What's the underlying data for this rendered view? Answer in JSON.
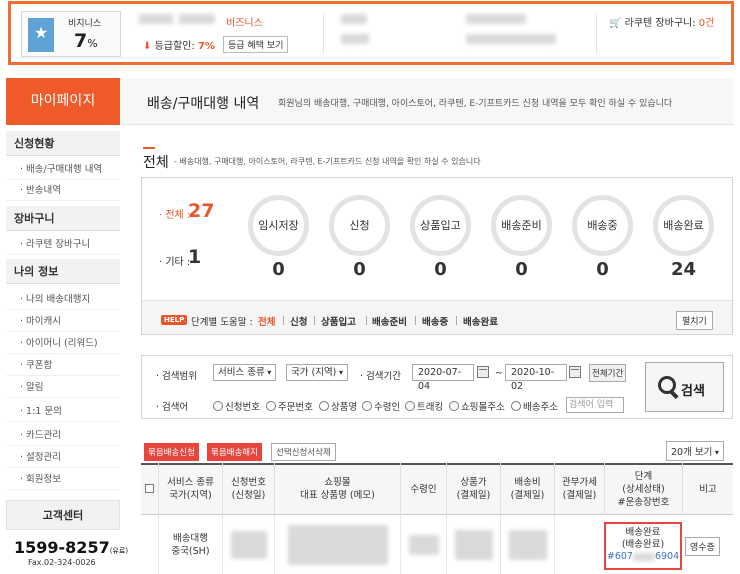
{
  "banner": {
    "grade_label": "비지니스",
    "grade_pct": "7",
    "grade_unit": "%",
    "biz_label": "비즈니스",
    "discount_label": "등급할인:",
    "discount_pct": "7%",
    "grade_btn": "등급 혜택 보기",
    "cart_label": "라쿠텐 장바구니:",
    "cart_count": "0건"
  },
  "sidebar": {
    "title": "마이페이지",
    "sections": [
      {
        "label": "신청현황",
        "items": [
          "배송/구매대행 내역",
          "반송내역"
        ]
      },
      {
        "label": "장바구니",
        "items": [
          "라쿠텐 장바구니"
        ]
      },
      {
        "label": "나의 정보",
        "items": [
          "나의 배송대행지",
          "마이캐시",
          "아이머니 (리워드)",
          "쿠폰함",
          "알림",
          "1:1 문의",
          "카드관리",
          "설정관리",
          "회원정보"
        ]
      }
    ],
    "cs_title": "고객센터",
    "cs_phone": "1599-8257",
    "cs_phone_suffix": "(유료)",
    "cs_fax": "Fax.02-324-0026"
  },
  "main": {
    "title": "배송/구매대행 내역",
    "desc": "회원님의 배송대행, 구매대행, 아이스토어, 라쿠텐, E-기프트카드 신청 내역을 모두 확인 하실 수 있습니다",
    "section_title": "전체",
    "section_desc": "- 배송대행, 구매대행, 아이스토어, 라쿠텐, E-기프트카드 신청 내역을 확인 하실 수 있습니다"
  },
  "status": {
    "total_label": "· 전체 :",
    "total_count": "27",
    "etc_label": "· 기타 :",
    "etc_count": "1",
    "stages": [
      {
        "label": "임시저장",
        "count": "0"
      },
      {
        "label": "신청",
        "count": "0"
      },
      {
        "label": "상품입고",
        "count": "0"
      },
      {
        "label": "배송준비",
        "count": "0"
      },
      {
        "label": "배송중",
        "count": "0"
      },
      {
        "label": "배송완료",
        "count": "24"
      }
    ],
    "help_badge": "HELP",
    "help_label": "단계별 도움말 :",
    "help_steps": [
      "전체",
      "신청",
      "상품입고",
      "배송준비",
      "배송중",
      "배송완료"
    ],
    "fold_btn": "펼치기"
  },
  "search": {
    "range_label": "· 검색범위",
    "service_select": "서비스 종류",
    "country_select": "국가 (지역)",
    "period_label": "· 검색기간",
    "date_from": "2020-07-04",
    "tilde": "~",
    "date_to": "2020-10-02",
    "all_period_btn": "전체기간",
    "keyword_label": "· 검색어",
    "radios": [
      "신청번호",
      "주문번호",
      "상품명",
      "수령인",
      "트래킹",
      "쇼핑몰주소",
      "배송주소"
    ],
    "keyword_placeholder": "검색어 입력",
    "search_btn": "검색"
  },
  "actions": {
    "bulk_request": "묶음배송신청",
    "bulk_cancel": "묶음배송해지",
    "delete_selected": "선택신청서삭제",
    "per_page": "20개 보기"
  },
  "table": {
    "headers": [
      "서비스 종류\n국가(지역)",
      "신청번호\n(신청일)",
      "쇼핑몰\n대표 상품명 (메모)",
      "수령인",
      "상품가\n(결제일)",
      "배송비\n(결제일)",
      "관부가세\n(결제일)",
      "단계\n(상세상태)\n#운송장번호",
      "비고"
    ],
    "row": {
      "service": "배송대행\n중국(SH)",
      "stage": "배송완료",
      "stage_detail": "(배송완료)",
      "tracking_left": "#607",
      "tracking_right": "6904",
      "receipt_btn": "영수증"
    }
  },
  "colors": {
    "accent": "#ef5a2a",
    "grade_badge": "#5fa3d6",
    "link": "#3a70c5",
    "alert_border": "#e8453c"
  }
}
